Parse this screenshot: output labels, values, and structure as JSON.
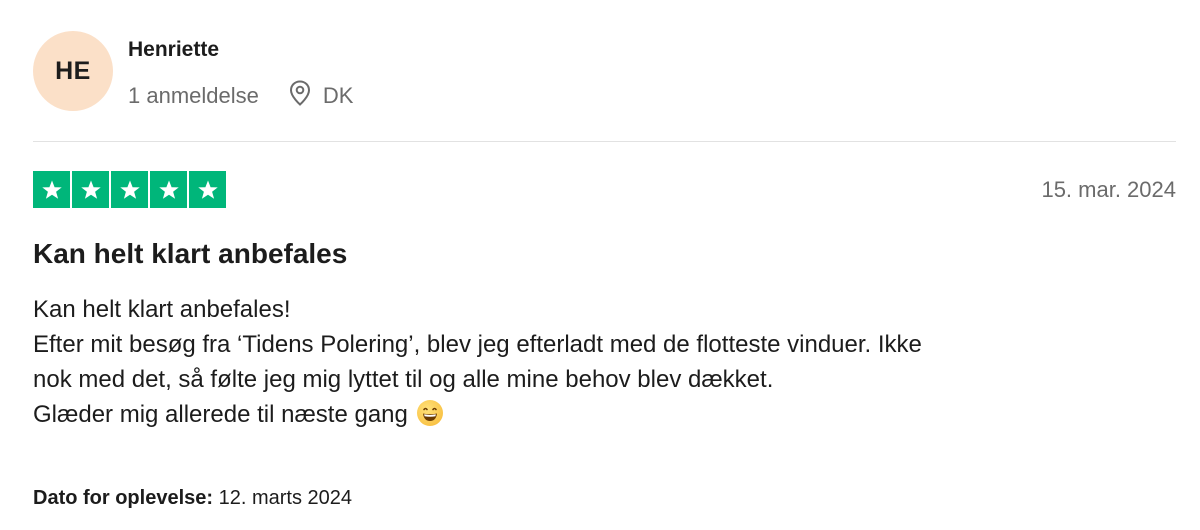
{
  "reviewer": {
    "initials": "HE",
    "name": "Henriette",
    "reviews_count": "1 anmeldelse",
    "country": "DK",
    "location_icon": "location-pin-icon"
  },
  "review": {
    "rating": 5,
    "star_color": "#00b67a",
    "date": "15. mar. 2024",
    "title": "Kan helt klart anbefales",
    "body_lines": [
      "Kan helt klart anbefales!",
      "Efter mit besøg fra ‘Tidens Polering’, blev jeg efterladt med de flotteste vinduer. Ikke",
      "nok med det, så følte jeg mig lyttet til og alle mine behov blev dækket.",
      "Glæder mig allerede til næste gang"
    ],
    "emoji": "grinning-face-icon",
    "experience_label": "Dato for oplevelse:",
    "experience_date": "12. marts 2024"
  }
}
